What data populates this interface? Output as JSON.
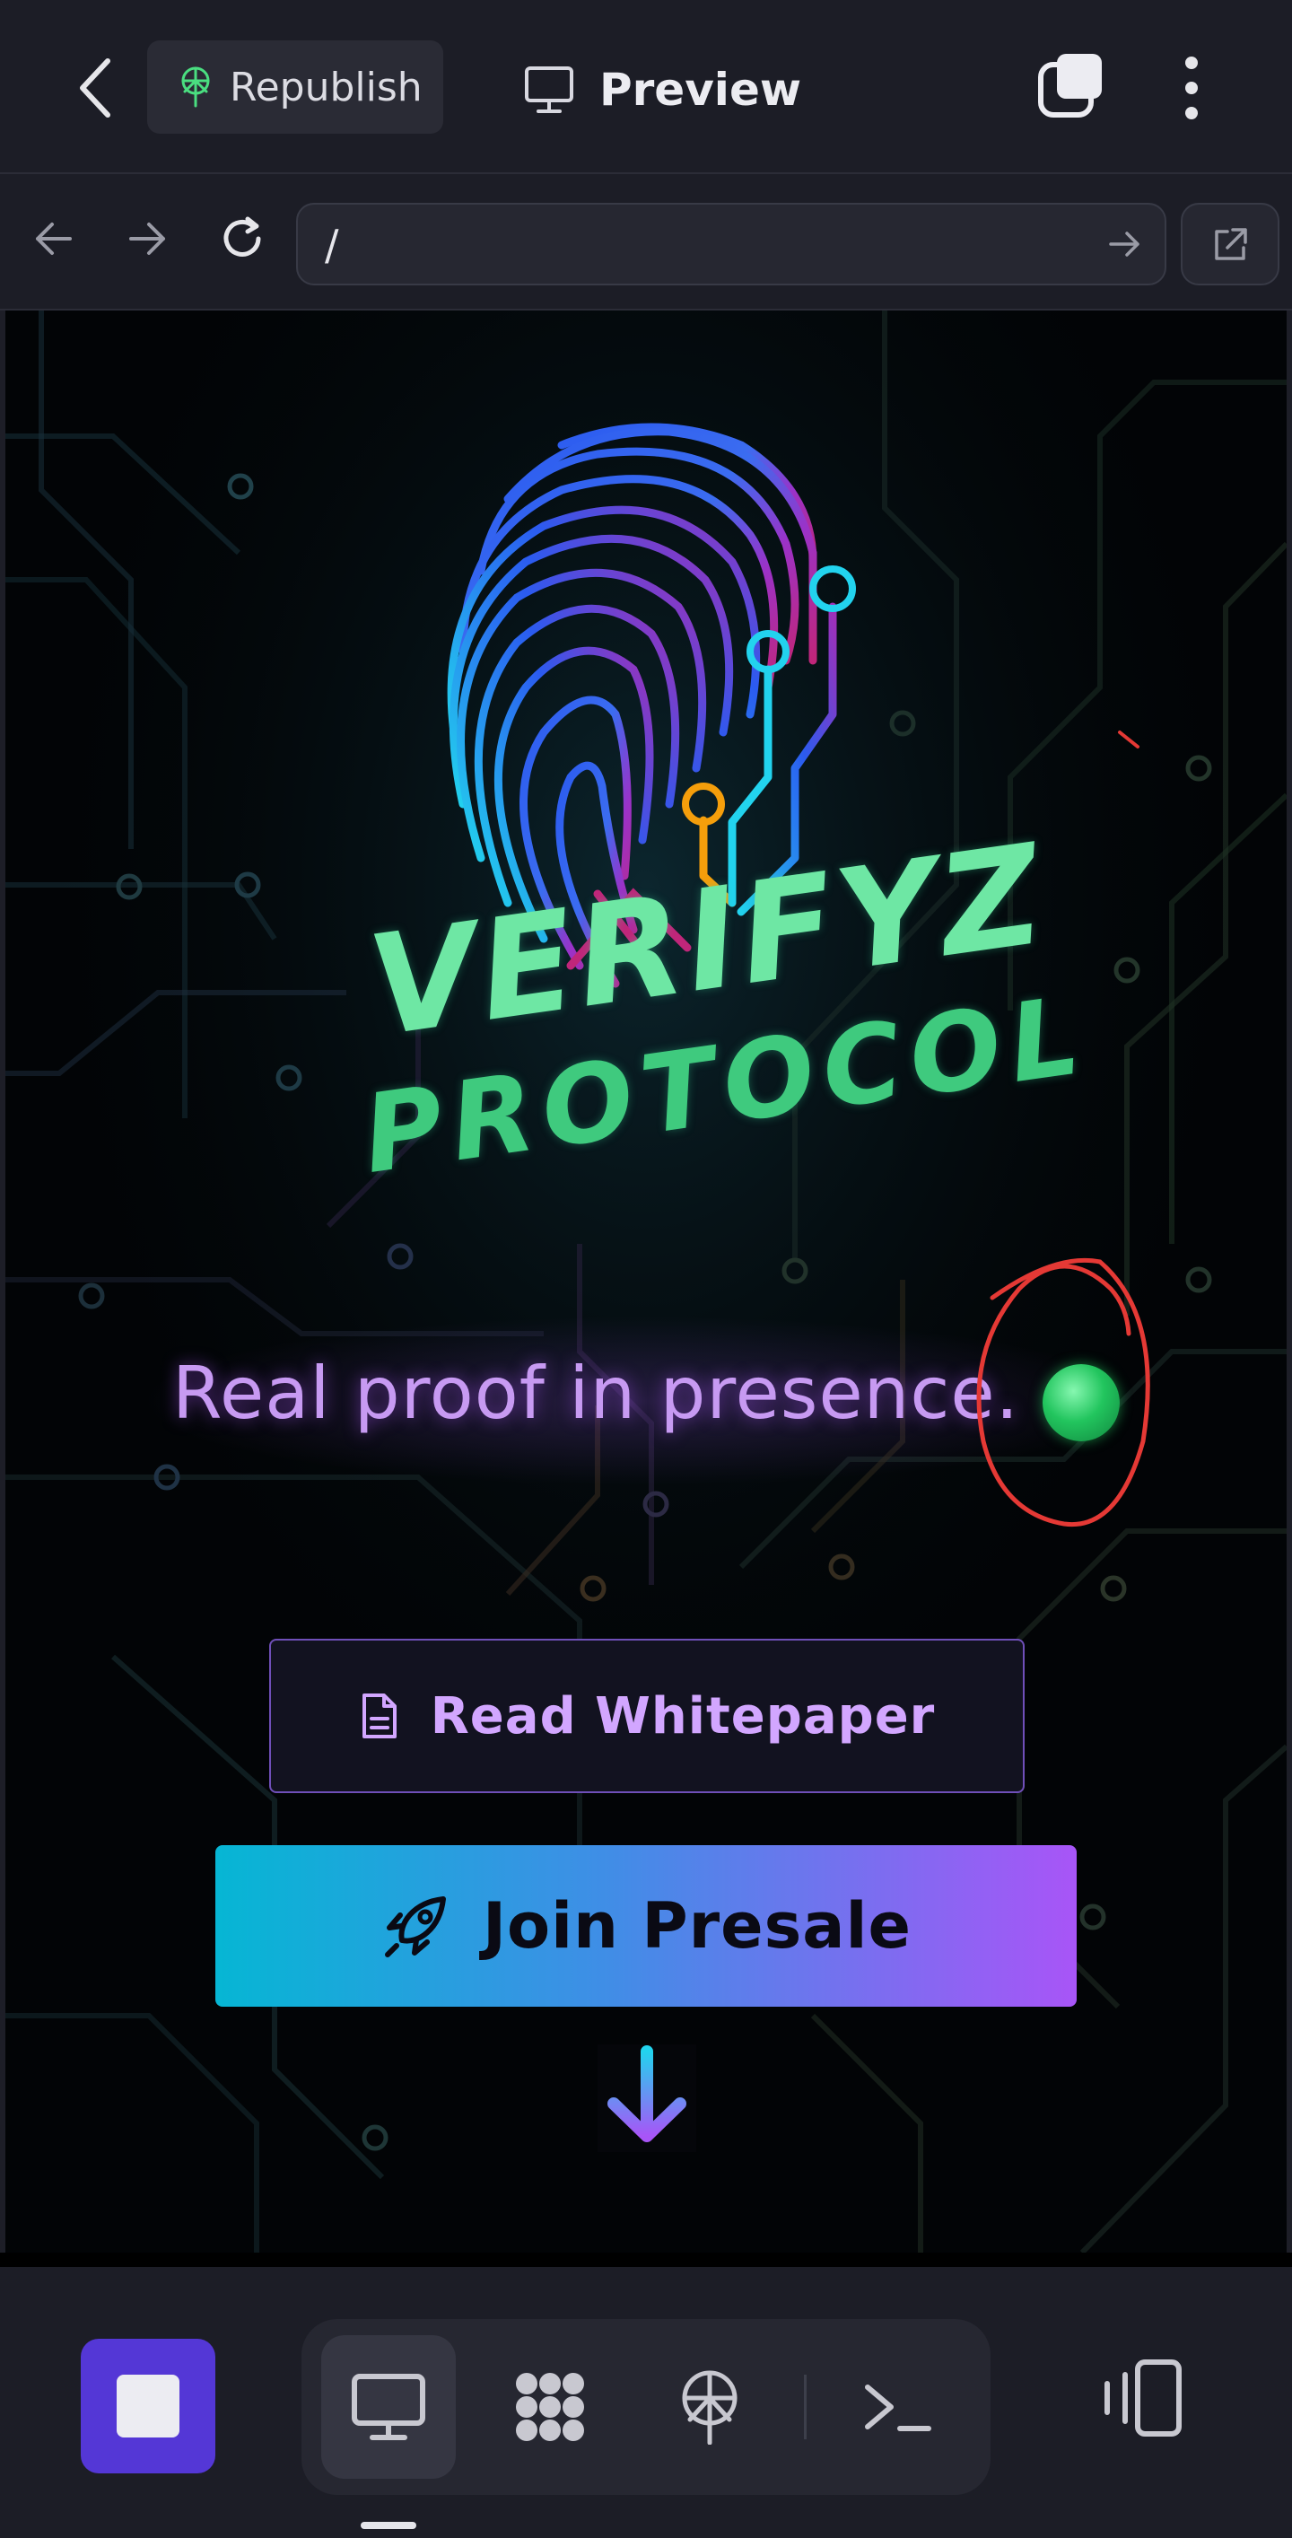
{
  "topbar": {
    "republish_label": "Republish",
    "preview_label": "Preview",
    "icons": [
      "chevron-left-icon",
      "antenna-icon",
      "monitor-icon",
      "tabs-icon",
      "kebab-icon"
    ]
  },
  "urlbar": {
    "url": "/",
    "icons": [
      "arrow-left-icon",
      "arrow-right-icon",
      "reload-icon",
      "arrow-right-icon",
      "external-link-icon"
    ]
  },
  "page": {
    "logo": {
      "line1": "VERIFYZ",
      "line2": "PROTOCOL"
    },
    "tagline": "Real proof in presence.",
    "whitepaper_button": "Read Whitepaper",
    "presale_button": "Join Presale",
    "colors": {
      "background": "#020406",
      "tagline": "#c79af2",
      "logo_text": "#6ee7a4",
      "button_gradient_start": "#06b6d4",
      "button_gradient_end": "#a855f7",
      "whitepaper_text": "#d2a6ff",
      "annotation": "#e53935"
    }
  },
  "bottombar": {
    "tools": [
      "monitor-icon",
      "modules-icon",
      "antenna-icon",
      "terminal-icon"
    ],
    "active_tool": "monitor-icon",
    "accent": "#5437d6"
  }
}
